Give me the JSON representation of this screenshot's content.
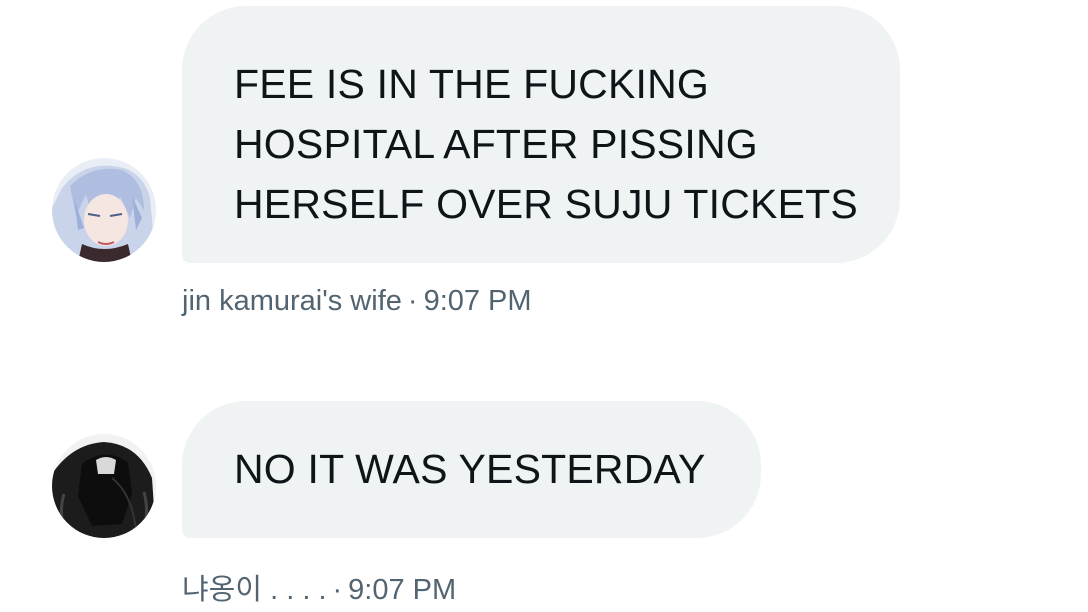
{
  "messages": [
    {
      "lines": [
        "FEE IS IN THE FUCKING",
        "HOSPITAL AFTER PISSING",
        "HERSELF OVER SUJU TICKETS"
      ],
      "sender": "jin kamurai's wife",
      "separator": "·",
      "time": "9:07 PM",
      "avatar": "anime-character-avatar"
    },
    {
      "lines": [
        "NO IT WAS YESTERDAY"
      ],
      "sender": "냐옹이 . . . .",
      "separator": "·",
      "time": "9:07 PM",
      "avatar": "dark-hair-figure-avatar"
    }
  ],
  "colors": {
    "bubble": "#eff3f4",
    "text": "#0f1419",
    "meta": "#536471"
  }
}
